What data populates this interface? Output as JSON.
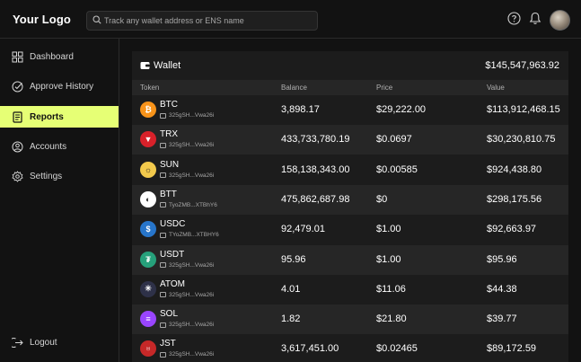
{
  "header": {
    "logo": "Your Logo",
    "search_placeholder": "Track any wallet address or ENS name"
  },
  "sidebar": {
    "items": [
      {
        "label": "Dashboard",
        "icon": "grid-icon"
      },
      {
        "label": "Approve History",
        "icon": "check-circle-icon"
      },
      {
        "label": "Reports",
        "icon": "document-icon",
        "active": true
      },
      {
        "label": "Accounts",
        "icon": "user-icon"
      },
      {
        "label": "Settings",
        "icon": "gear-icon"
      }
    ],
    "logout": "Logout"
  },
  "wallet": {
    "title": "Wallet",
    "total": "$145,547,963.92",
    "columns": [
      "Token",
      "Balance",
      "Price",
      "Value"
    ],
    "rows": [
      {
        "symbol": "BTC",
        "address": "325gSH...Vwa26i",
        "balance": "3,898.17",
        "price": "$29,222.00",
        "value": "$113,912,468.15",
        "color": "#f7931a"
      },
      {
        "symbol": "TRX",
        "address": "325gSH...Vwa26i",
        "balance": "433,733,780.19",
        "price": "$0.0697",
        "value": "$30,230,810.75",
        "color": "#d8212a"
      },
      {
        "symbol": "SUN",
        "address": "325gSH...Vwa26i",
        "balance": "158,138,343.00",
        "price": "$0.00585",
        "value": "$924,438.80",
        "color": "#f2c94c"
      },
      {
        "symbol": "BTT",
        "address": "TyoZMB...XTBhY6",
        "balance": "475,862,687.98",
        "price": "$0",
        "value": "$298,175.56",
        "color": "#ffffff"
      },
      {
        "symbol": "USDC",
        "address": "TYoZMB...XTBHY6",
        "balance": "92,479.01",
        "price": "$1.00",
        "value": "$92,663.97",
        "color": "#2775ca"
      },
      {
        "symbol": "USDT",
        "address": "325gSH...Vwa26i",
        "balance": "95.96",
        "price": "$1.00",
        "value": "$95.96",
        "color": "#26a17b"
      },
      {
        "symbol": "ATOM",
        "address": "325gSH...Vwa26i",
        "balance": "4.01",
        "price": "$11.06",
        "value": "$44.38",
        "color": "#2e3148"
      },
      {
        "symbol": "SOL",
        "address": "325gSH...Vwa26i",
        "balance": "1.82",
        "price": "$21.80",
        "value": "$39.77",
        "color": "#9945ff"
      },
      {
        "symbol": "JST",
        "address": "325gSH...Vwa26i",
        "balance": "3,617,451.00",
        "price": "$0.02465",
        "value": "$89,172.59",
        "color": "#c62828"
      }
    ]
  }
}
